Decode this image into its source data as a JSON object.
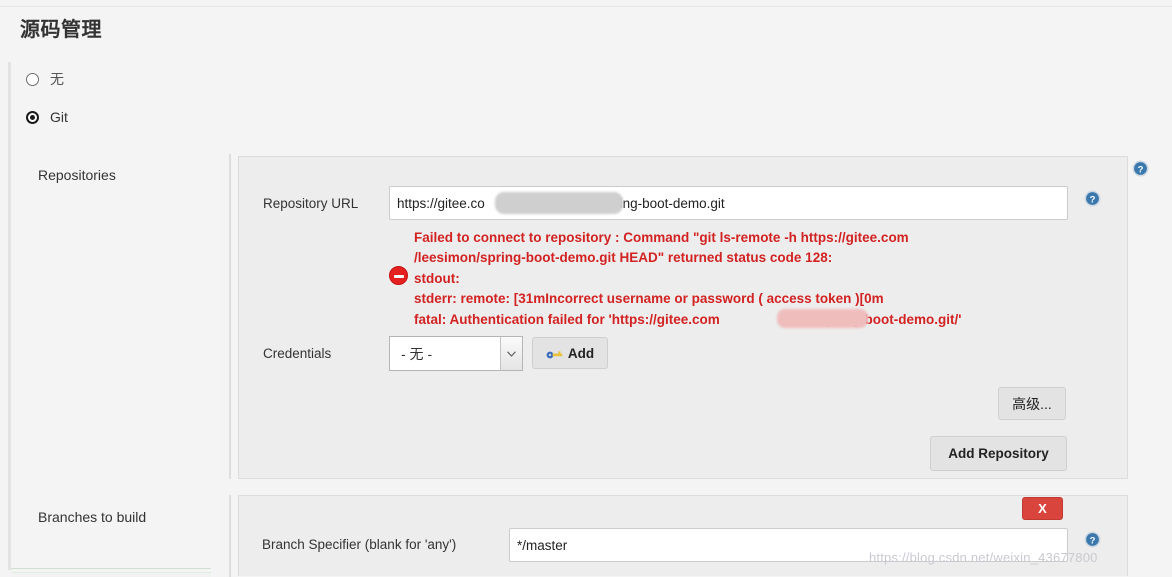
{
  "page": {
    "section_title": "源码管理",
    "watermark": "https://blog.csdn.net/weixin_43677800"
  },
  "scm_options": [
    {
      "label": "无",
      "checked": false
    },
    {
      "label": "Git",
      "checked": true
    }
  ],
  "repositories": {
    "group_label": "Repositories",
    "repository_url": {
      "label": "Repository URL",
      "value": "https://gitee.co",
      "value_tail": "spring-boot-demo.git",
      "redacted": true
    },
    "error": {
      "icon": "error-circle-icon",
      "text": "Failed to connect to repository : Command \"git ls-remote -h https://gitee.com\n/leesimon/spring-boot-demo.git HEAD\" returned status code 128:\nstdout:\nstderr: remote: [31mIncorrect username or password ( access token )[0m\nfatal: Authentication failed for 'https://gitee.com",
      "text_tail": "spring-boot-demo.git/'",
      "color": "#d32222"
    },
    "credentials": {
      "label": "Credentials",
      "selected": "- 无 -",
      "options": [
        "- 无 -"
      ],
      "add_button": "Add"
    },
    "advanced_button": "高级...",
    "add_repository_button": "Add Repository"
  },
  "branches": {
    "group_label": "Branches to build",
    "delete_button": "X",
    "branch_specifier": {
      "label": "Branch Specifier (blank for 'any')",
      "value": "*/master"
    }
  },
  "help": {
    "glyph": "?",
    "color": "#3b78ad"
  }
}
